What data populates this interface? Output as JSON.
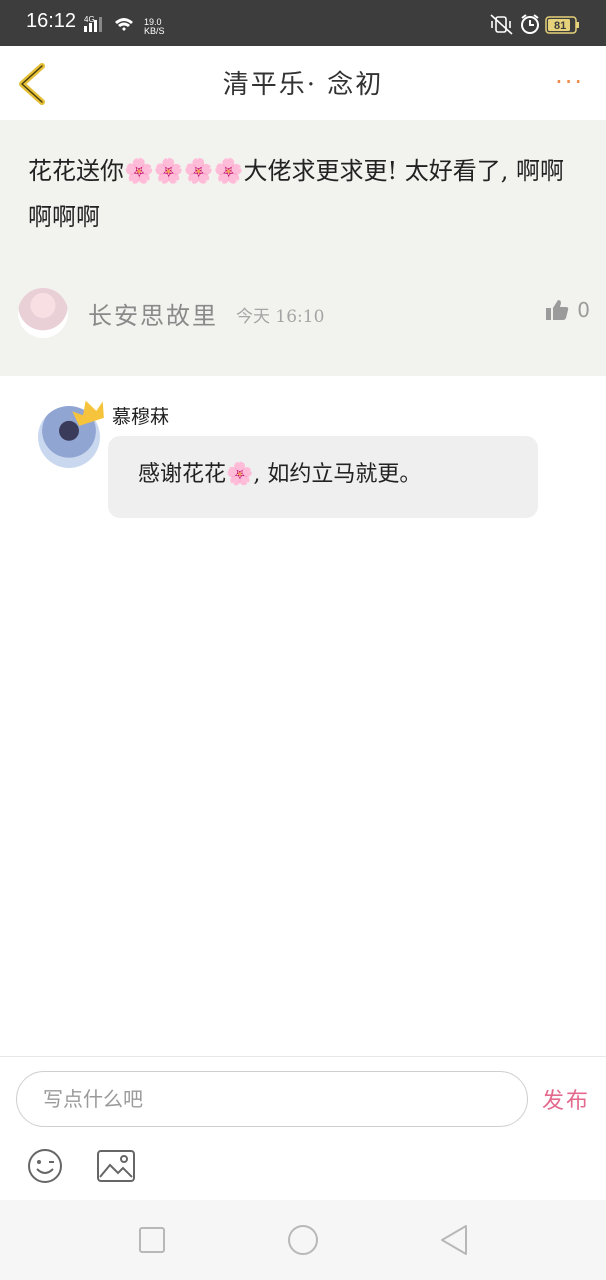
{
  "status_bar": {
    "time": "16:12",
    "network": "4G",
    "speed": "19.0",
    "speed_unit": "KB/S",
    "battery": "81"
  },
  "header": {
    "title": "清平乐· 念初",
    "more_label": "···"
  },
  "post": {
    "text_before_emojis": "花花送你",
    "emojis": "🌸🌸🌸🌸",
    "text_after_emojis": "大佬求更求更!  太好看了,  啊啊啊啊啊",
    "author": "长安思故里",
    "time": "今天  16:10",
    "likes": "0"
  },
  "reply": {
    "name": "慕穆菻",
    "text_before": "感谢花花",
    "emoji": "🌸",
    "text_after": ",  如约立马就更。"
  },
  "composer": {
    "placeholder": "写点什么吧",
    "publish_label": "发布"
  },
  "colors": {
    "back_arrow": "#e3bf35",
    "more_dots": "#f08a4b",
    "publish": "#e46a8d",
    "post_bg": "#f2f2ee"
  }
}
